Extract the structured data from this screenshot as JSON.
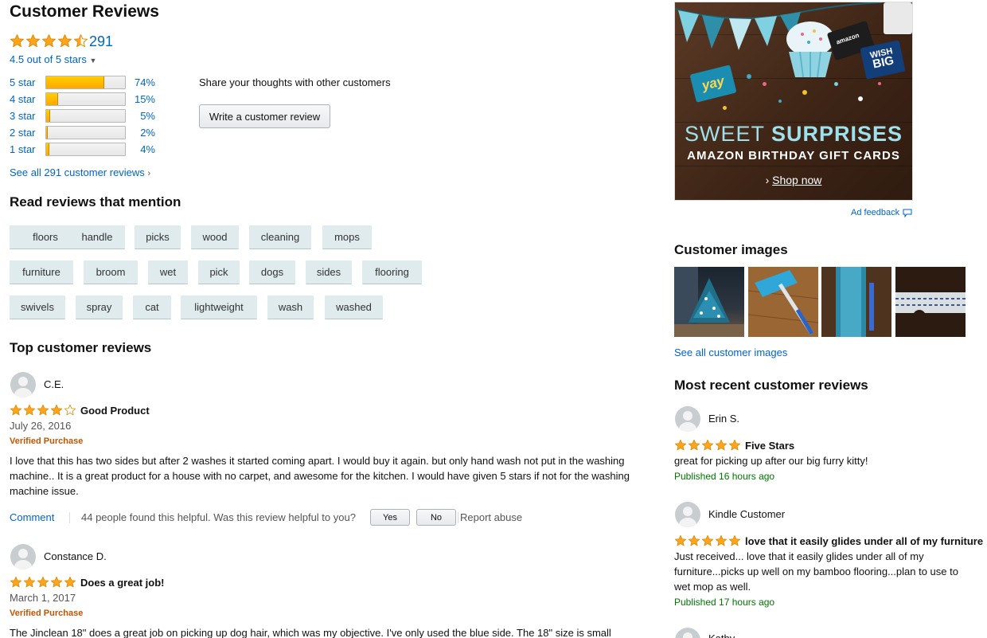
{
  "summary": {
    "title": "Customer Reviews",
    "rating_count": "291",
    "rating_text": "4.5 out of 5 stars",
    "rating_value": 4.5,
    "histogram": [
      {
        "label": "5 star",
        "percent": "74%",
        "value": 74
      },
      {
        "label": "4 star",
        "percent": "15%",
        "value": 15
      },
      {
        "label": "3 star",
        "percent": "5%",
        "value": 5
      },
      {
        "label": "2 star",
        "percent": "2%",
        "value": 2
      },
      {
        "label": "1 star",
        "percent": "4%",
        "value": 4
      }
    ],
    "see_all": "See all 291 customer reviews"
  },
  "share": {
    "prompt": "Share your thoughts with other customers",
    "button": "Write a customer review"
  },
  "mentions": {
    "heading": "Read reviews that mention",
    "tags": [
      "floors",
      "handle",
      "picks",
      "wood",
      "cleaning",
      "mops",
      "furniture",
      "broom",
      "wet",
      "pick",
      "dogs",
      "sides",
      "flooring",
      "swivels",
      "spray",
      "cat",
      "lightweight",
      "wash",
      "washed"
    ]
  },
  "top_reviews": {
    "heading": "Top customer reviews",
    "items": [
      {
        "name": "C.E.",
        "rating": 4,
        "title": "Good Product",
        "date": "July 26, 2016",
        "verified": "Verified Purchase",
        "body": "I love that this has two sides but after 2 washes it started coming apart. I would buy it again. but only hand wash not put in the washing machine.. It is a great product for a house with no carpet, and awesome for the kitchen. I would have given 5 stars if not for the washing machine issue.",
        "comment": "Comment",
        "helpful": "44 people found this helpful. Was this review helpful to you?",
        "yes": "Yes",
        "no": "No",
        "report": "Report abuse"
      },
      {
        "name": "Constance D.",
        "rating": 5,
        "title": "Does a great job!",
        "date": "March 1, 2017",
        "verified": "Verified Purchase",
        "body": "The Jinclean 18\" does a great job on picking up dog hair, which was my objective. I've only used the blue side. The 18\" size is small"
      }
    ]
  },
  "ad": {
    "headline_light": "SWEET",
    "headline_bold": "SURPRISES",
    "subline": "AMAZON BIRTHDAY GIFT CARDS",
    "cta": "Shop now",
    "card_yay": "yay",
    "card_brand": "amazon",
    "card_wish_1": "WISH",
    "card_wish_2": "BIG",
    "feedback": "Ad feedback",
    "colors": {
      "flag": "#7fd0e0",
      "flag_dark": "#2f8fa8",
      "headline": "#9ee0ec"
    }
  },
  "customer_images": {
    "heading": "Customer images",
    "see_all": "See all customer images",
    "images": [
      "christmas-tree-photo",
      "mop-on-floor-photo",
      "mop-pad-closeup-photo",
      "mop-pad-texture-photo"
    ]
  },
  "recent": {
    "heading": "Most recent customer reviews",
    "items": [
      {
        "name": "Erin S.",
        "rating": 5,
        "title": "Five Stars",
        "body": "great for picking up after our big furry kitty!",
        "published": "Published 16 hours ago"
      },
      {
        "name": "Kindle Customer",
        "rating": 5,
        "title": "love that it easily glides under all of my furniture",
        "body": "Just received... love that it easily glides under all of my furniture...picks up well on my bamboo flooring...plan to use to wet mop as well.",
        "published": "Published 17 hours ago"
      },
      {
        "name": "Kathy"
      }
    ]
  },
  "colors": {
    "link": "#0066c0",
    "star": "#ffa41c",
    "verified": "#c45500",
    "published": "#007600",
    "tag_bg": "#e0ebee"
  }
}
